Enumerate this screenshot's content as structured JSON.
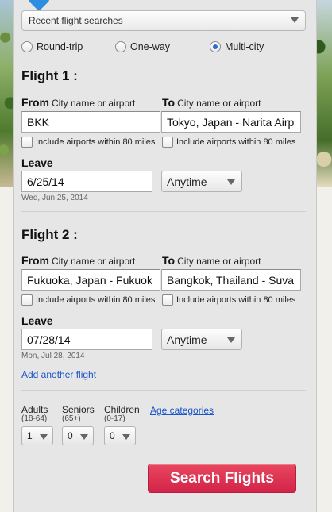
{
  "recent_searches": {
    "label": "Recent flight searches"
  },
  "trip_type": {
    "options": [
      "Round-trip",
      "One-way",
      "Multi-city"
    ],
    "selected": "Multi-city"
  },
  "flights": [
    {
      "title": "Flight 1 :",
      "from_label": "From",
      "from_hint": "City name or airport",
      "from_value": "BKK",
      "to_label": "To",
      "to_hint": "City name or airport",
      "to_value": "Tokyo, Japan - Narita Airp",
      "nearby_label": "Include airports within 80 miles",
      "leave_label": "Leave",
      "date_value": "6/25/14",
      "date_hint": "Wed, Jun 25, 2014",
      "time_value": "Anytime"
    },
    {
      "title": "Flight 2 :",
      "from_label": "From",
      "from_hint": "City name or airport",
      "from_value": "Fukuoka, Japan - Fukuok",
      "to_label": "To",
      "to_hint": "City name or airport",
      "to_value": "Bangkok, Thailand - Suva",
      "nearby_label": "Include airports within 80 miles",
      "leave_label": "Leave",
      "date_value": "07/28/14",
      "date_hint": "Mon, Jul 28, 2014",
      "time_value": "Anytime"
    }
  ],
  "add_flight_link": "Add another flight",
  "travelers": {
    "adults_label": "Adults",
    "adults_sub": "(18-64)",
    "adults_value": "1",
    "seniors_label": "Seniors",
    "seniors_sub": "(65+)",
    "seniors_value": "0",
    "children_label": "Children",
    "children_sub": "(0-17)",
    "children_value": "0",
    "age_link": "Age categories"
  },
  "search_button": "Search Flights",
  "colors": {
    "accent_blue": "#2d8ee0",
    "search_red": "#d32449",
    "link_blue": "#1a55c9"
  },
  "icons": [
    "chevron-down-icon",
    "radio-icon",
    "checkbox-icon"
  ]
}
